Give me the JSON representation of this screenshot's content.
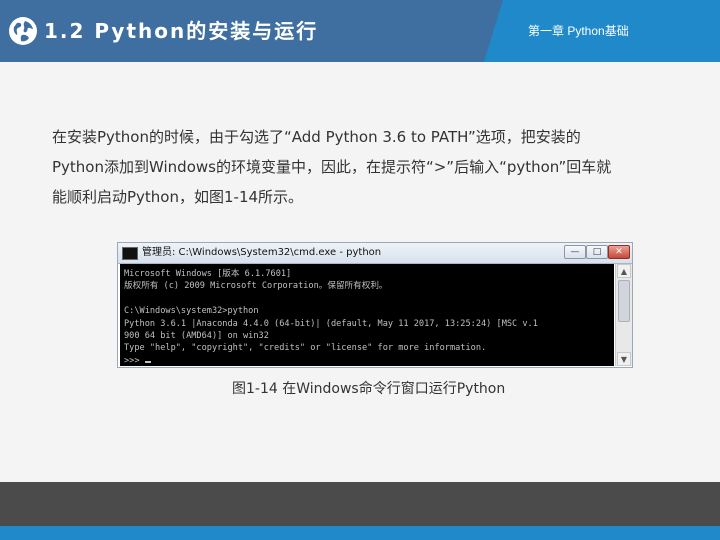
{
  "header": {
    "title": "1.2  Python的安装与运行",
    "chapter": "第一章 Python基础",
    "icon": "globe-icon"
  },
  "content": {
    "paragraph_lines": [
      "在安装Python的时候，由于勾选了“Add Python 3.6 to PATH”选项，把安装的",
      "Python添加到Windows的环境变量中，因此，在提示符“>”后输入“python”回车就",
      "能顺利启动Python，如图1-14所示。"
    ]
  },
  "figure": {
    "window_title": "管理员: C:\\Windows\\System32\\cmd.exe - python",
    "buttons": {
      "minimize": "—",
      "maximize": "□",
      "close": "✕"
    },
    "console_lines": [
      "Microsoft Windows [版本 6.1.7601]",
      "版权所有 (c) 2009 Microsoft Corporation。保留所有权利。",
      "",
      "C:\\Windows\\system32>python",
      "Python 3.6.1 |Anaconda 4.4.0 (64-bit)| (default, May 11 2017, 13:25:24) [MSC v.1",
      "900 64 bit (AMD64)] on win32",
      "Type \"help\", \"copyright\", \"credits\" or \"license\" for more information.",
      ">>> "
    ],
    "caption": "图1-14  在Windows命令行窗口运行Python"
  },
  "colors": {
    "header_dark": "#3f6fa0",
    "header_light": "#1f89c9",
    "footer_dark": "#4b4b4b",
    "footer_blue": "#1f89c9"
  }
}
